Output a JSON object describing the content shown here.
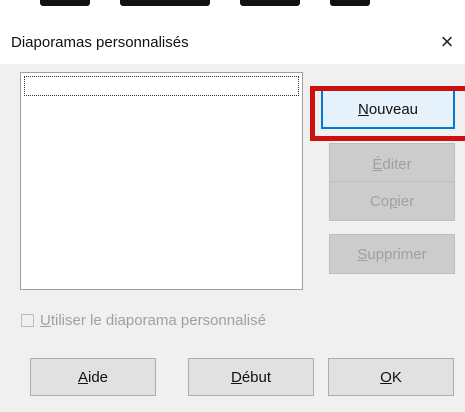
{
  "dialog": {
    "title": "Diaporamas personnalisés",
    "close_symbol": "×"
  },
  "buttons": {
    "new": {
      "pre": "",
      "key": "N",
      "post": "ouveau"
    },
    "edit": {
      "pre": "",
      "key": "É",
      "post": "diter"
    },
    "copy": {
      "pre": "Co",
      "key": "p",
      "post": "ier"
    },
    "delete": {
      "pre": "",
      "key": "S",
      "post": "upprimer"
    },
    "help": {
      "pre": "",
      "key": "A",
      "post": "ide"
    },
    "start": {
      "pre": "",
      "key": "D",
      "post": "ébut"
    },
    "ok": {
      "pre": "",
      "key": "O",
      "post": "K"
    }
  },
  "checkbox": {
    "pre": "",
    "key": "U",
    "post": "tiliser le diaporama personnalisé",
    "checked": false,
    "enabled": false
  },
  "shows_list": [],
  "colors": {
    "highlight": "#cc1111",
    "default_button_border": "#0078d7"
  }
}
